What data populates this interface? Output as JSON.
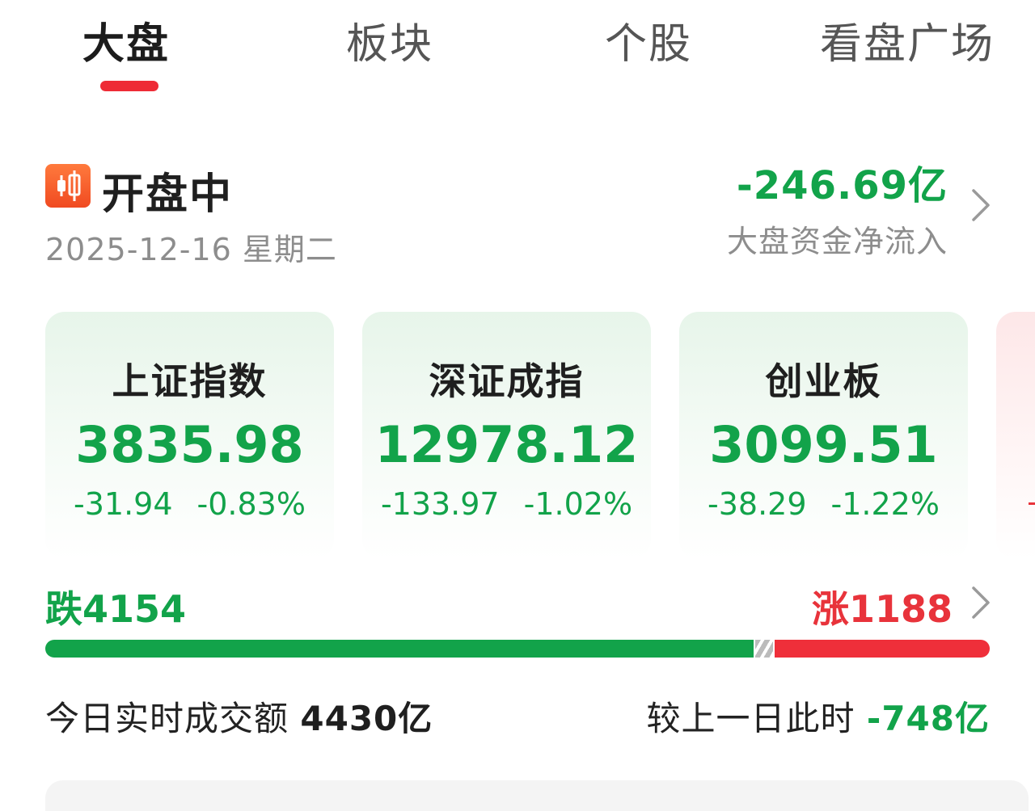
{
  "tabs": [
    {
      "label": "大盘",
      "active": true
    },
    {
      "label": "板块",
      "active": false
    },
    {
      "label": "个股",
      "active": false
    },
    {
      "label": "看盘广场",
      "active": false
    }
  ],
  "status": {
    "title": "开盘中",
    "date": "2025-12-16 星期二",
    "icon": "candlestick-icon"
  },
  "net_flow": {
    "value": "-246.69亿",
    "label": "大盘资金净流入"
  },
  "indices": [
    {
      "name": "上证指数",
      "value": "3835.98",
      "change": "-31.94",
      "change_pct": "-0.83%"
    },
    {
      "name": "深证成指",
      "value": "12978.12",
      "change": "-133.97",
      "change_pct": "-1.02%"
    },
    {
      "name": "创业板",
      "value": "3099.51",
      "change": "-38.29",
      "change_pct": "-1.22%"
    }
  ],
  "advance_decline": {
    "down_label": "跌4154",
    "up_label": "涨1188",
    "down_share": 0.75,
    "flat_share": 0.022,
    "up_share": 0.228
  },
  "turnover": {
    "label": "今日实时成交额",
    "value": "4430亿",
    "compare_label": "较上一日此时",
    "compare_value": "-748亿"
  },
  "colors": {
    "up": "#e8333b",
    "down": "#12a34a",
    "accent": "#ee2b36"
  }
}
